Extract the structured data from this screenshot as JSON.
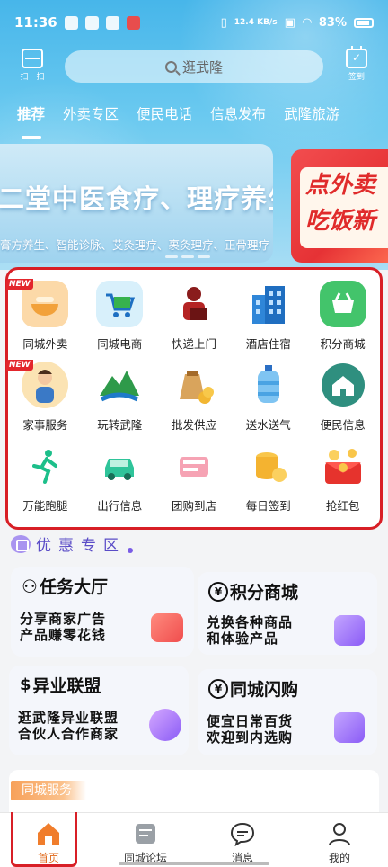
{
  "status_bar": {
    "time": "11:36",
    "network_speed": "12.4 KB/s",
    "battery": "83%"
  },
  "header": {
    "scan_label": "扫一扫",
    "search_placeholder": "逛武隆",
    "signin_label": "签到"
  },
  "tabs": [
    {
      "label": "推荐",
      "active": true
    },
    {
      "label": "外卖专区"
    },
    {
      "label": "便民电话"
    },
    {
      "label": "信息发布"
    },
    {
      "label": "武隆旅游"
    }
  ],
  "banner": {
    "title": "二堂中医食疗、理疗养生馆",
    "subtitle": "膏方养生、智能诊脉、艾灸理疗、裹灸理疗、正骨理疗",
    "secondary_text": "点外卖 吃饭新"
  },
  "services": [
    {
      "label": "同城外卖",
      "icon": "takeout-bowl-icon",
      "badge": "NEW"
    },
    {
      "label": "同城电商",
      "icon": "shopping-cart-icon"
    },
    {
      "label": "快递上门",
      "icon": "courier-icon"
    },
    {
      "label": "酒店住宿",
      "icon": "hotel-building-icon"
    },
    {
      "label": "积分商城",
      "icon": "basket-icon"
    },
    {
      "label": "家事服务",
      "icon": "housekeeper-icon",
      "badge": "NEW"
    },
    {
      "label": "玩转武隆",
      "icon": "mountain-river-icon"
    },
    {
      "label": "批发供应",
      "icon": "grain-sack-icon"
    },
    {
      "label": "送水送气",
      "icon": "water-bottle-icon"
    },
    {
      "label": "便民信息",
      "icon": "house-info-icon"
    },
    {
      "label": "万能跑腿",
      "icon": "runner-icon"
    },
    {
      "label": "出行信息",
      "icon": "car-icon"
    },
    {
      "label": "团购到店",
      "icon": "ticket-icon"
    },
    {
      "label": "每日签到",
      "icon": "coins-icon"
    },
    {
      "label": "抢红包",
      "icon": "red-packet-icon"
    }
  ],
  "coupon_section": {
    "title": "优惠专区"
  },
  "promos": [
    {
      "title": "任务大厅",
      "desc_line1": "分享商家广告",
      "desc_line2": "产品赚零花钱"
    },
    {
      "title": "积分商城",
      "desc_line1": "兑换各种商品",
      "desc_line2": "和体验产品"
    },
    {
      "title": "异业联盟",
      "desc_line1": "逛武隆异业联盟",
      "desc_line2": "合伙人合作商家"
    },
    {
      "title": "同城闪购",
      "desc_line1": "便宜日常百货",
      "desc_line2": "欢迎到内选购"
    }
  ],
  "city_service": {
    "label": "同城服务"
  },
  "bottom_nav": [
    {
      "label": "首页",
      "icon": "home-icon",
      "active": true
    },
    {
      "label": "同城论坛",
      "icon": "forum-icon"
    },
    {
      "label": "消息",
      "icon": "message-icon"
    },
    {
      "label": "我的",
      "icon": "profile-icon"
    }
  ],
  "colors": {
    "accent": "#e06a1b",
    "highlight": "#d81f26",
    "sky": "#47b6ea"
  }
}
